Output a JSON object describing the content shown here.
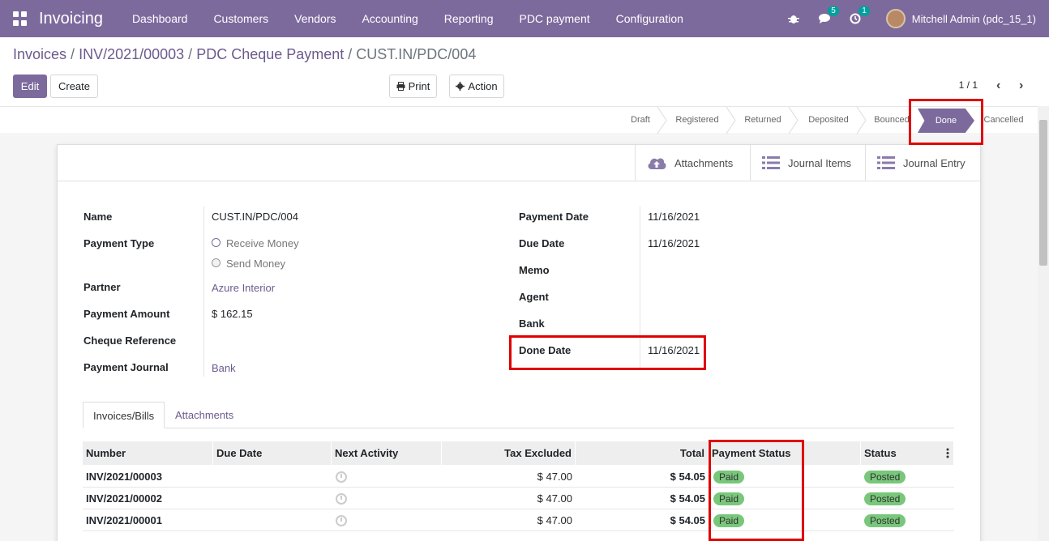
{
  "navbar": {
    "app_title": "Invoicing",
    "menu": [
      "Dashboard",
      "Customers",
      "Vendors",
      "Accounting",
      "Reporting",
      "PDC payment",
      "Configuration"
    ],
    "messages_count": "5",
    "activities_count": "1",
    "user": "Mitchell Admin (pdc_15_1)"
  },
  "breadcrumb": {
    "items": [
      "Invoices",
      "INV/2021/00003",
      "PDC Cheque Payment"
    ],
    "current": "CUST.IN/PDC/004"
  },
  "toolbar": {
    "edit": "Edit",
    "create": "Create",
    "print": "Print",
    "action": "Action",
    "pager": "1 / 1"
  },
  "statusbar": {
    "stages": [
      "Draft",
      "Registered",
      "Returned",
      "Deposited",
      "Bounced",
      "Done",
      "Cancelled"
    ],
    "active": "Done"
  },
  "smart_buttons": {
    "attachments": "Attachments",
    "journal_items": "Journal Items",
    "journal_entry": "Journal Entry"
  },
  "form": {
    "labels": {
      "name": "Name",
      "payment_type": "Payment Type",
      "partner": "Partner",
      "payment_amount": "Payment Amount",
      "cheque_reference": "Cheque Reference",
      "payment_journal": "Payment Journal",
      "payment_date": "Payment Date",
      "due_date": "Due Date",
      "memo": "Memo",
      "agent": "Agent",
      "bank": "Bank",
      "done_date": "Done Date"
    },
    "values": {
      "name": "CUST.IN/PDC/004",
      "payment_type_options": [
        "Receive Money",
        "Send Money"
      ],
      "payment_type_selected": "Receive Money",
      "partner": "Azure Interior",
      "payment_amount": "$ 162.15",
      "payment_journal": "Bank",
      "payment_date": "11/16/2021",
      "due_date": "11/16/2021",
      "done_date": "11/16/2021"
    }
  },
  "tabs": [
    "Invoices/Bills",
    "Attachments"
  ],
  "table": {
    "columns": [
      "Number",
      "Due Date",
      "Next Activity",
      "Tax Excluded",
      "Total",
      "Payment Status",
      "Status"
    ],
    "rows": [
      {
        "number": "INV/2021/00003",
        "tax_excluded": "$ 47.00",
        "total": "$ 54.05",
        "payment_status": "Paid",
        "status": "Posted"
      },
      {
        "number": "INV/2021/00002",
        "tax_excluded": "$ 47.00",
        "total": "$ 54.05",
        "payment_status": "Paid",
        "status": "Posted"
      },
      {
        "number": "INV/2021/00001",
        "tax_excluded": "$ 47.00",
        "total": "$ 54.05",
        "payment_status": "Paid",
        "status": "Posted"
      }
    ]
  },
  "colors": {
    "brand": "#7c6a9d",
    "highlight": "#e00000",
    "badge_paid": "#78c77a"
  }
}
